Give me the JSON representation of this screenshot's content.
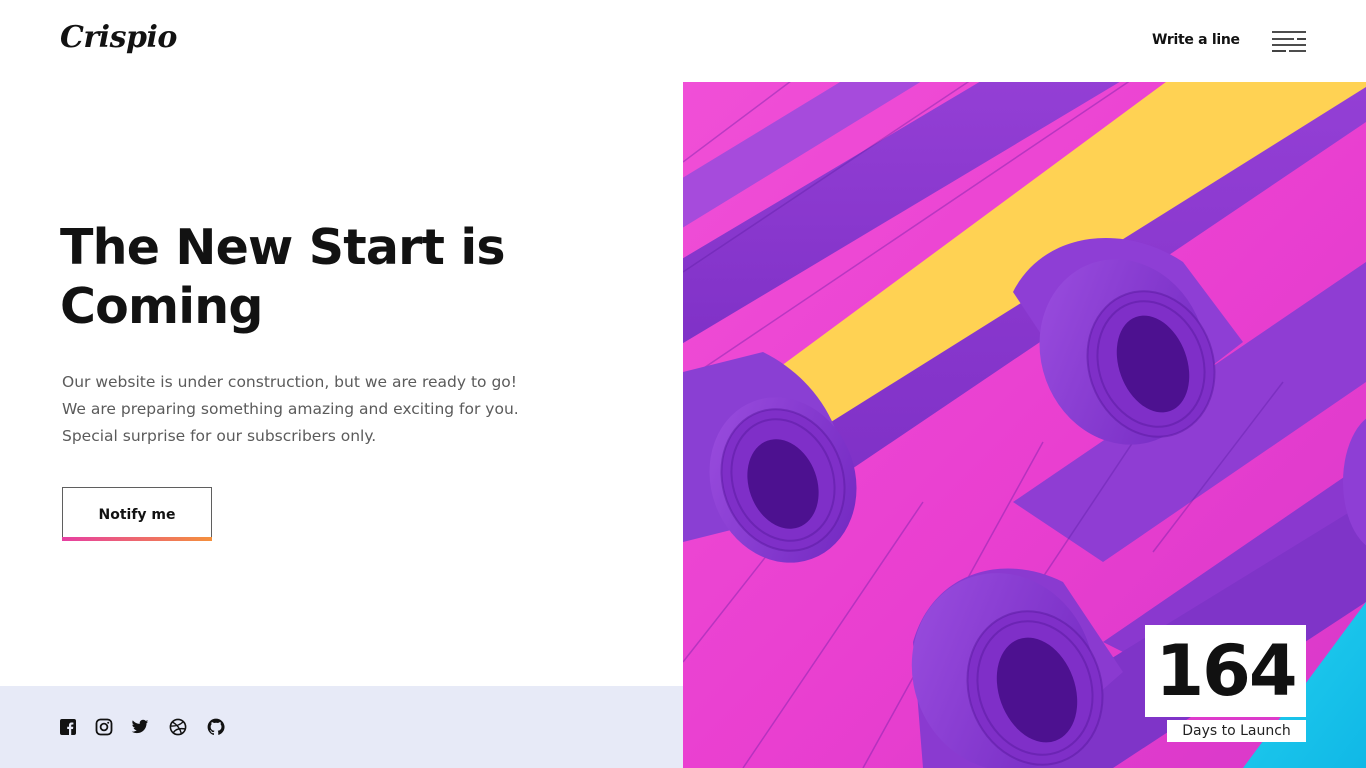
{
  "header": {
    "logo": "Crispio",
    "write_link": "Write a line",
    "menu_icon": "menu-lines-icon"
  },
  "hero": {
    "title": "The New Start is Coming",
    "description": [
      "Our website is under construction, but we are ready to go!",
      "We are preparing something amazing and exciting for you.",
      "Special surprise for our subscribers only."
    ],
    "notify_label": "Notify me"
  },
  "social": {
    "icons": [
      "facebook-icon",
      "instagram-icon",
      "twitter-icon",
      "dribbble-icon",
      "github-icon"
    ]
  },
  "countdown": {
    "value": "164",
    "label": "Days to Launch"
  },
  "colors": {
    "accent_gradient_start": "#e63fa2",
    "accent_gradient_end": "#f4903c",
    "footer_bg": "#e7eaf7",
    "text_dark": "#121212",
    "purple": "#8a3fd0",
    "magenta": "#ea3fcf",
    "yellow": "#ffd253",
    "cyan": "#19c6ec"
  }
}
